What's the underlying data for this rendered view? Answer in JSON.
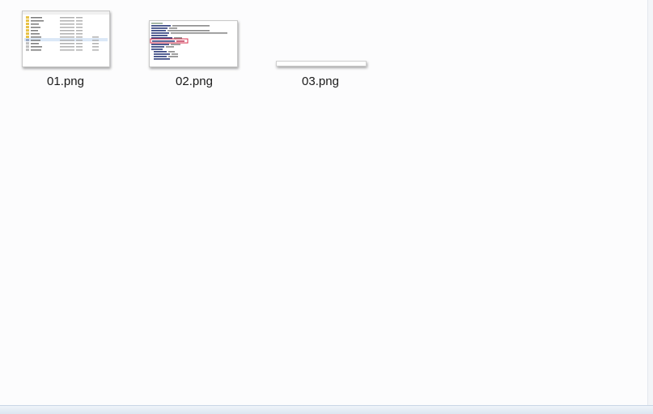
{
  "files": [
    {
      "name": "01.png",
      "thumb": "file-list-preview"
    },
    {
      "name": "02.png",
      "thumb": "code-preview"
    },
    {
      "name": "03.png",
      "thumb": "status-strip-preview"
    }
  ]
}
